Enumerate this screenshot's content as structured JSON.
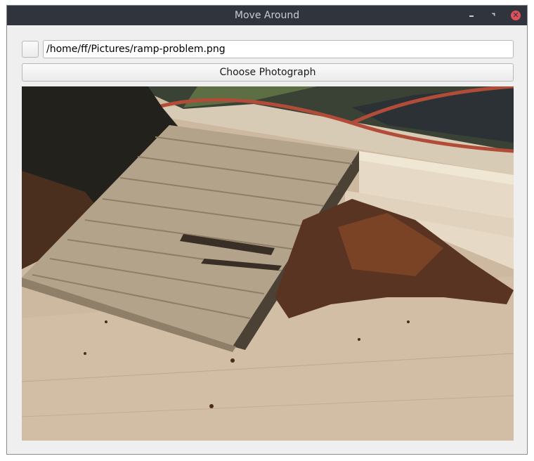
{
  "window": {
    "title": "Move Around",
    "controls": {
      "minimize_icon": "minimize-icon",
      "maximize_icon": "restore-icon",
      "close_icon": "close-icon",
      "close_glyph": "✕"
    },
    "colors": {
      "titlebar": "#30343d",
      "close": "#e0505a"
    }
  },
  "form": {
    "checkbox_checked": false,
    "path_value": "/home/ff/Pictures/ramp-problem.png",
    "choose_label": "Choose Photograph"
  }
}
